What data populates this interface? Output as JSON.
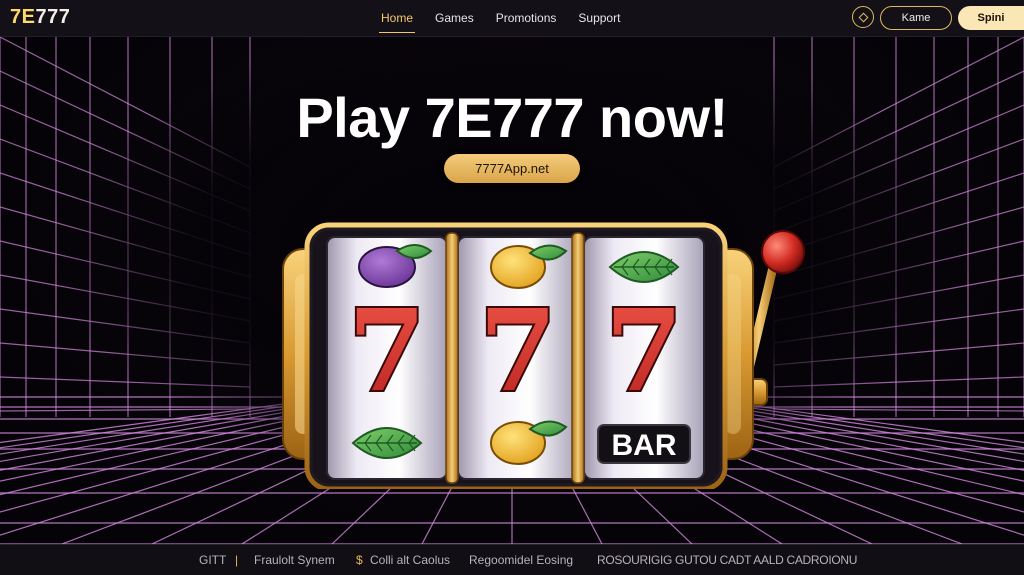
{
  "brand": {
    "logo_part1": "7E",
    "logo_part2": "777"
  },
  "nav": {
    "items": [
      {
        "label": "Home",
        "active": true
      },
      {
        "label": "Games"
      },
      {
        "label": "Promotions"
      },
      {
        "label": "Support"
      }
    ]
  },
  "header_actions": {
    "outline_button": "Kame",
    "solid_button": "Spini"
  },
  "hero": {
    "headline": "Play 7E777 now!",
    "url_pill": "​7777App.net"
  },
  "slot_machine": {
    "reels": [
      {
        "top": "plum",
        "middle": "7",
        "bottom": "leaf"
      },
      {
        "top": "lemon",
        "middle": "7",
        "bottom": "lemon"
      },
      {
        "top": "leaf",
        "middle": "7",
        "bottom": "BAR"
      }
    ],
    "bar_label": "BAR"
  },
  "footer": {
    "item1": "GITT",
    "separator": "|",
    "item2": "Fraulolt Synem",
    "item3": "Colli alt Caolus",
    "item4": "Regoomidel Eosing",
    "item5": "ROSOURIGIG GUTOU CADT AALD CADROIONU"
  },
  "colors": {
    "accent_gold": "#e2b85e",
    "grid_pink": "#d58be0",
    "seven_red": "#d63a35"
  }
}
